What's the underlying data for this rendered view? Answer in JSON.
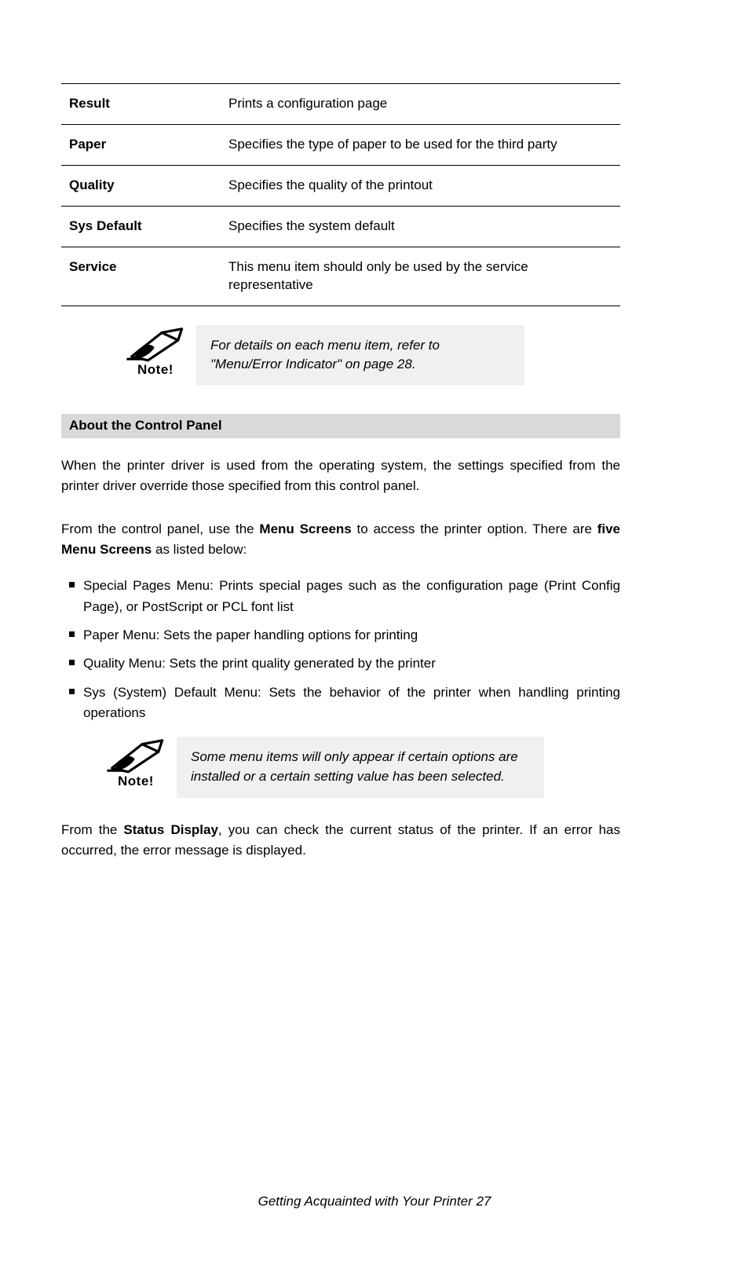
{
  "table": {
    "rows": [
      {
        "label": "Result",
        "value": "Prints a configuration page"
      },
      {
        "label": "Paper",
        "value": "Specifies the type of paper to be used for the third party"
      },
      {
        "label": "Quality",
        "value": "Specifies the quality of the printout"
      },
      {
        "label": "Sys Default",
        "value": "Specifies the system default"
      },
      {
        "label": "Service",
        "value": "This menu item should only be used by the service representative"
      }
    ]
  },
  "note1": "For details on each menu item, refer to \"Menu/Error Indicator\" on page 28.",
  "section_title": "About the Control Panel",
  "para1": "When the printer driver is used from the operating system, the settings specified from the printer driver override those specified from this control panel.",
  "para2_lead": "From the control panel, use the ",
  "para2_bold1": "Menu Screens",
  "para2_mid": " to access the printer option. There are ",
  "para2_bold2": "five Menu Screens",
  "para2_tail": " as listed below:",
  "list": [
    "Special Pages Menu: Prints special pages such as the configuration page (Print Config Page), or PostScript or PCL font list",
    "Paper Menu: Sets the paper handling options for printing",
    "Quality Menu: Sets the print quality generated by the printer",
    "Sys (System) Default Menu: Sets the behavior of the printer when handling printing operations"
  ],
  "note2": "Some menu items will only appear if certain options are installed or a certain setting value has been selected.",
  "para3_pre": "From the ",
  "para3_bold": "Status Display",
  "para3_post": ", you can check the current status of the printer. If an error has occurred, the error message is displayed.",
  "page_number": "Getting Acquainted with Your Printer 27"
}
